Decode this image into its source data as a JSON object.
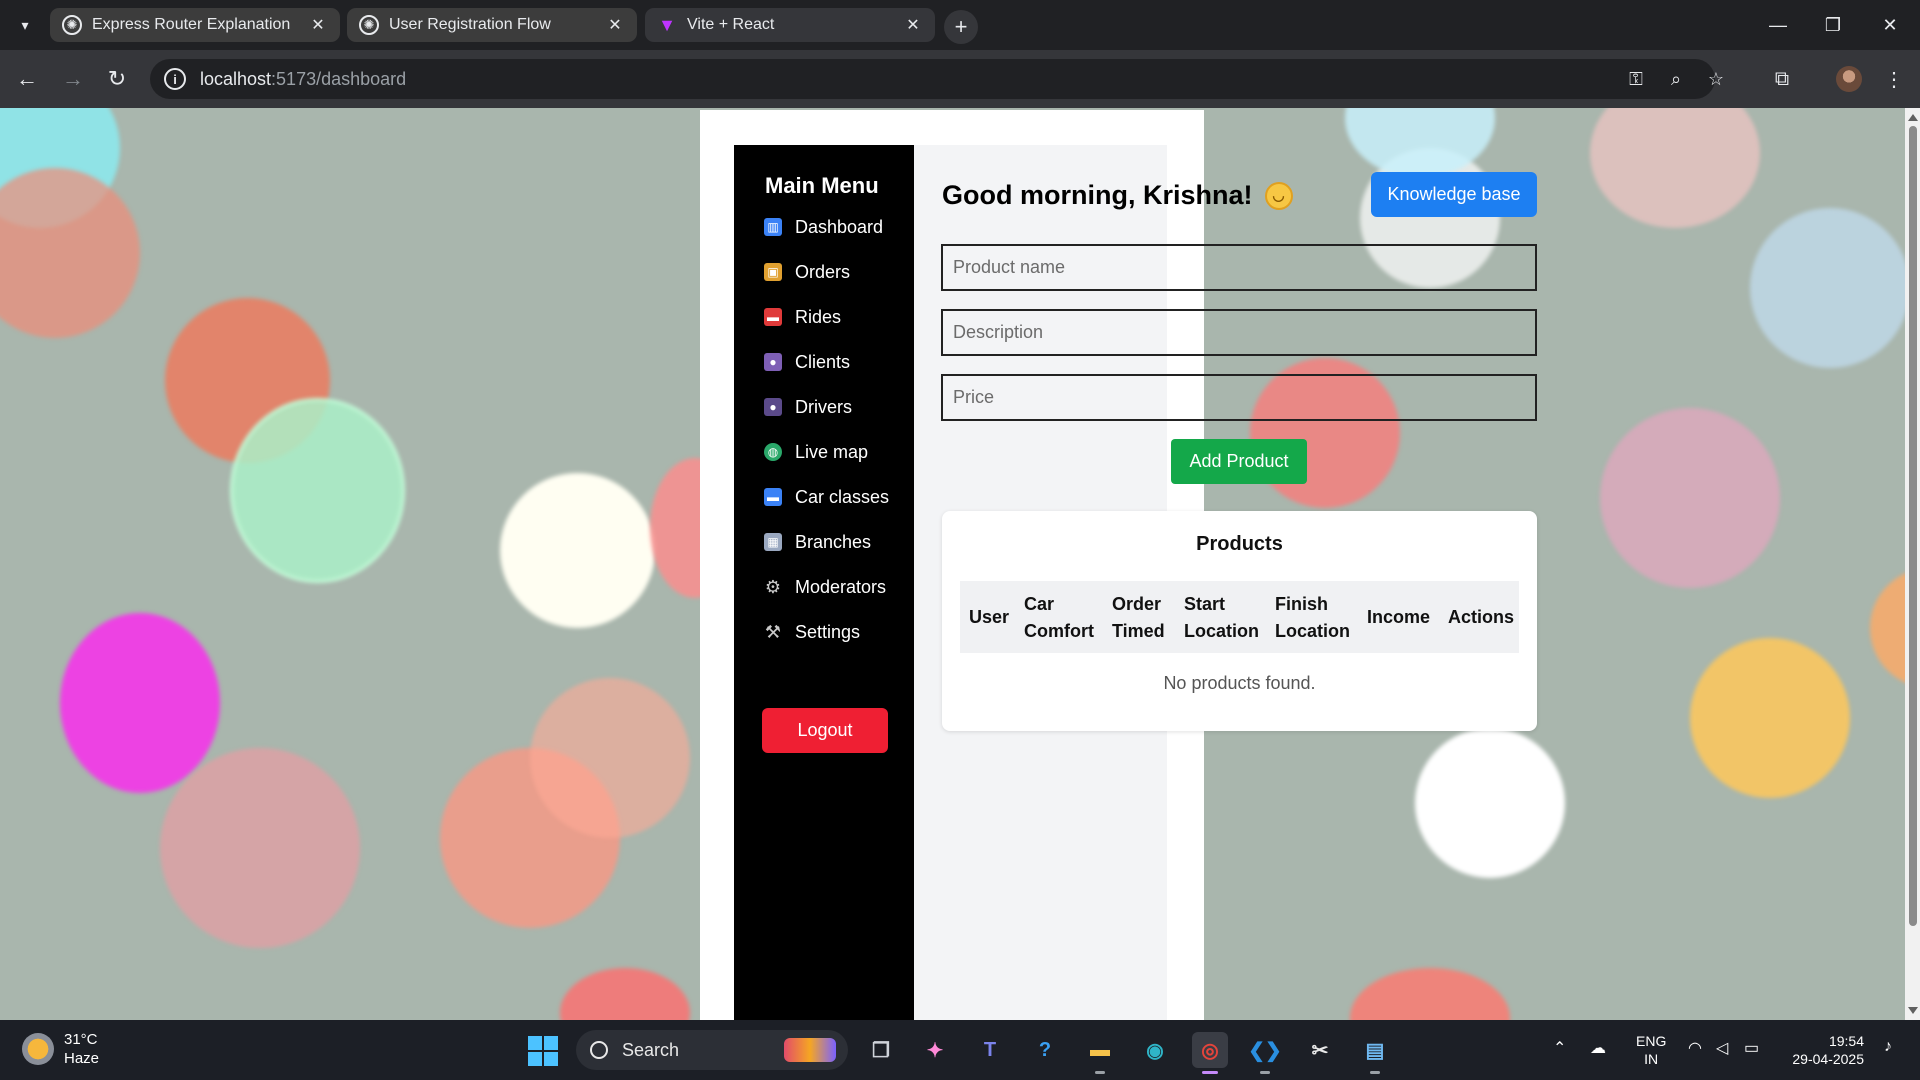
{
  "browser": {
    "tabs": [
      {
        "title": "Express Router Explanation",
        "favicon": "chatgpt-icon",
        "active": false
      },
      {
        "title": "User Registration Flow",
        "favicon": "chatgpt-icon",
        "active": false
      },
      {
        "title": "Vite + React",
        "favicon": "vite-icon",
        "active": true
      }
    ],
    "url_host": "localhost",
    "url_path": ":5173/dashboard"
  },
  "sidebar": {
    "title": "Main Menu",
    "items": [
      {
        "label": "Dashboard",
        "icon": "dashboard-icon",
        "color": "#3b82f6"
      },
      {
        "label": "Orders",
        "icon": "package-icon",
        "color": "#e0a030"
      },
      {
        "label": "Rides",
        "icon": "car-icon",
        "color": "#e03a3a"
      },
      {
        "label": "Clients",
        "icon": "users-icon",
        "color": "#7e5fb5"
      },
      {
        "label": "Drivers",
        "icon": "user-icon",
        "color": "#5b4a8a"
      },
      {
        "label": "Live map",
        "icon": "globe-icon",
        "color": "#2aa86a"
      },
      {
        "label": "Car classes",
        "icon": "car-icon",
        "color": "#3b82f6"
      },
      {
        "label": "Branches",
        "icon": "building-icon",
        "color": "#9aa8c0"
      },
      {
        "label": "Moderators",
        "icon": "gear-icon",
        "color": "#c9c9c9"
      },
      {
        "label": "Settings",
        "icon": "tools-icon",
        "color": "#c9c9c9"
      }
    ],
    "logout_label": "Logout"
  },
  "main": {
    "greeting": "Good morning, Krishna!",
    "knowledge_base_label": "Knowledge base",
    "form": {
      "product_name_placeholder": "Product name",
      "description_placeholder": "Description",
      "price_placeholder": "Price",
      "add_label": "Add Product"
    },
    "products": {
      "title": "Products",
      "columns": [
        "User",
        "Car Comfort",
        "Order Timed",
        "Start Location",
        "Finish Location",
        "Income",
        "Actions"
      ],
      "empty_text": "No products found."
    }
  },
  "colors": {
    "sidebar_bg": "#000000",
    "logout": "#ef1f33",
    "knowledge_base": "#1d7ff2",
    "add_product": "#14a84a"
  },
  "taskbar": {
    "weather_temp": "31°C",
    "weather_desc": "Haze",
    "search_label": "Search",
    "lang_line1": "ENG",
    "lang_line2": "IN",
    "time": "19:54",
    "date": "29-04-2025"
  }
}
